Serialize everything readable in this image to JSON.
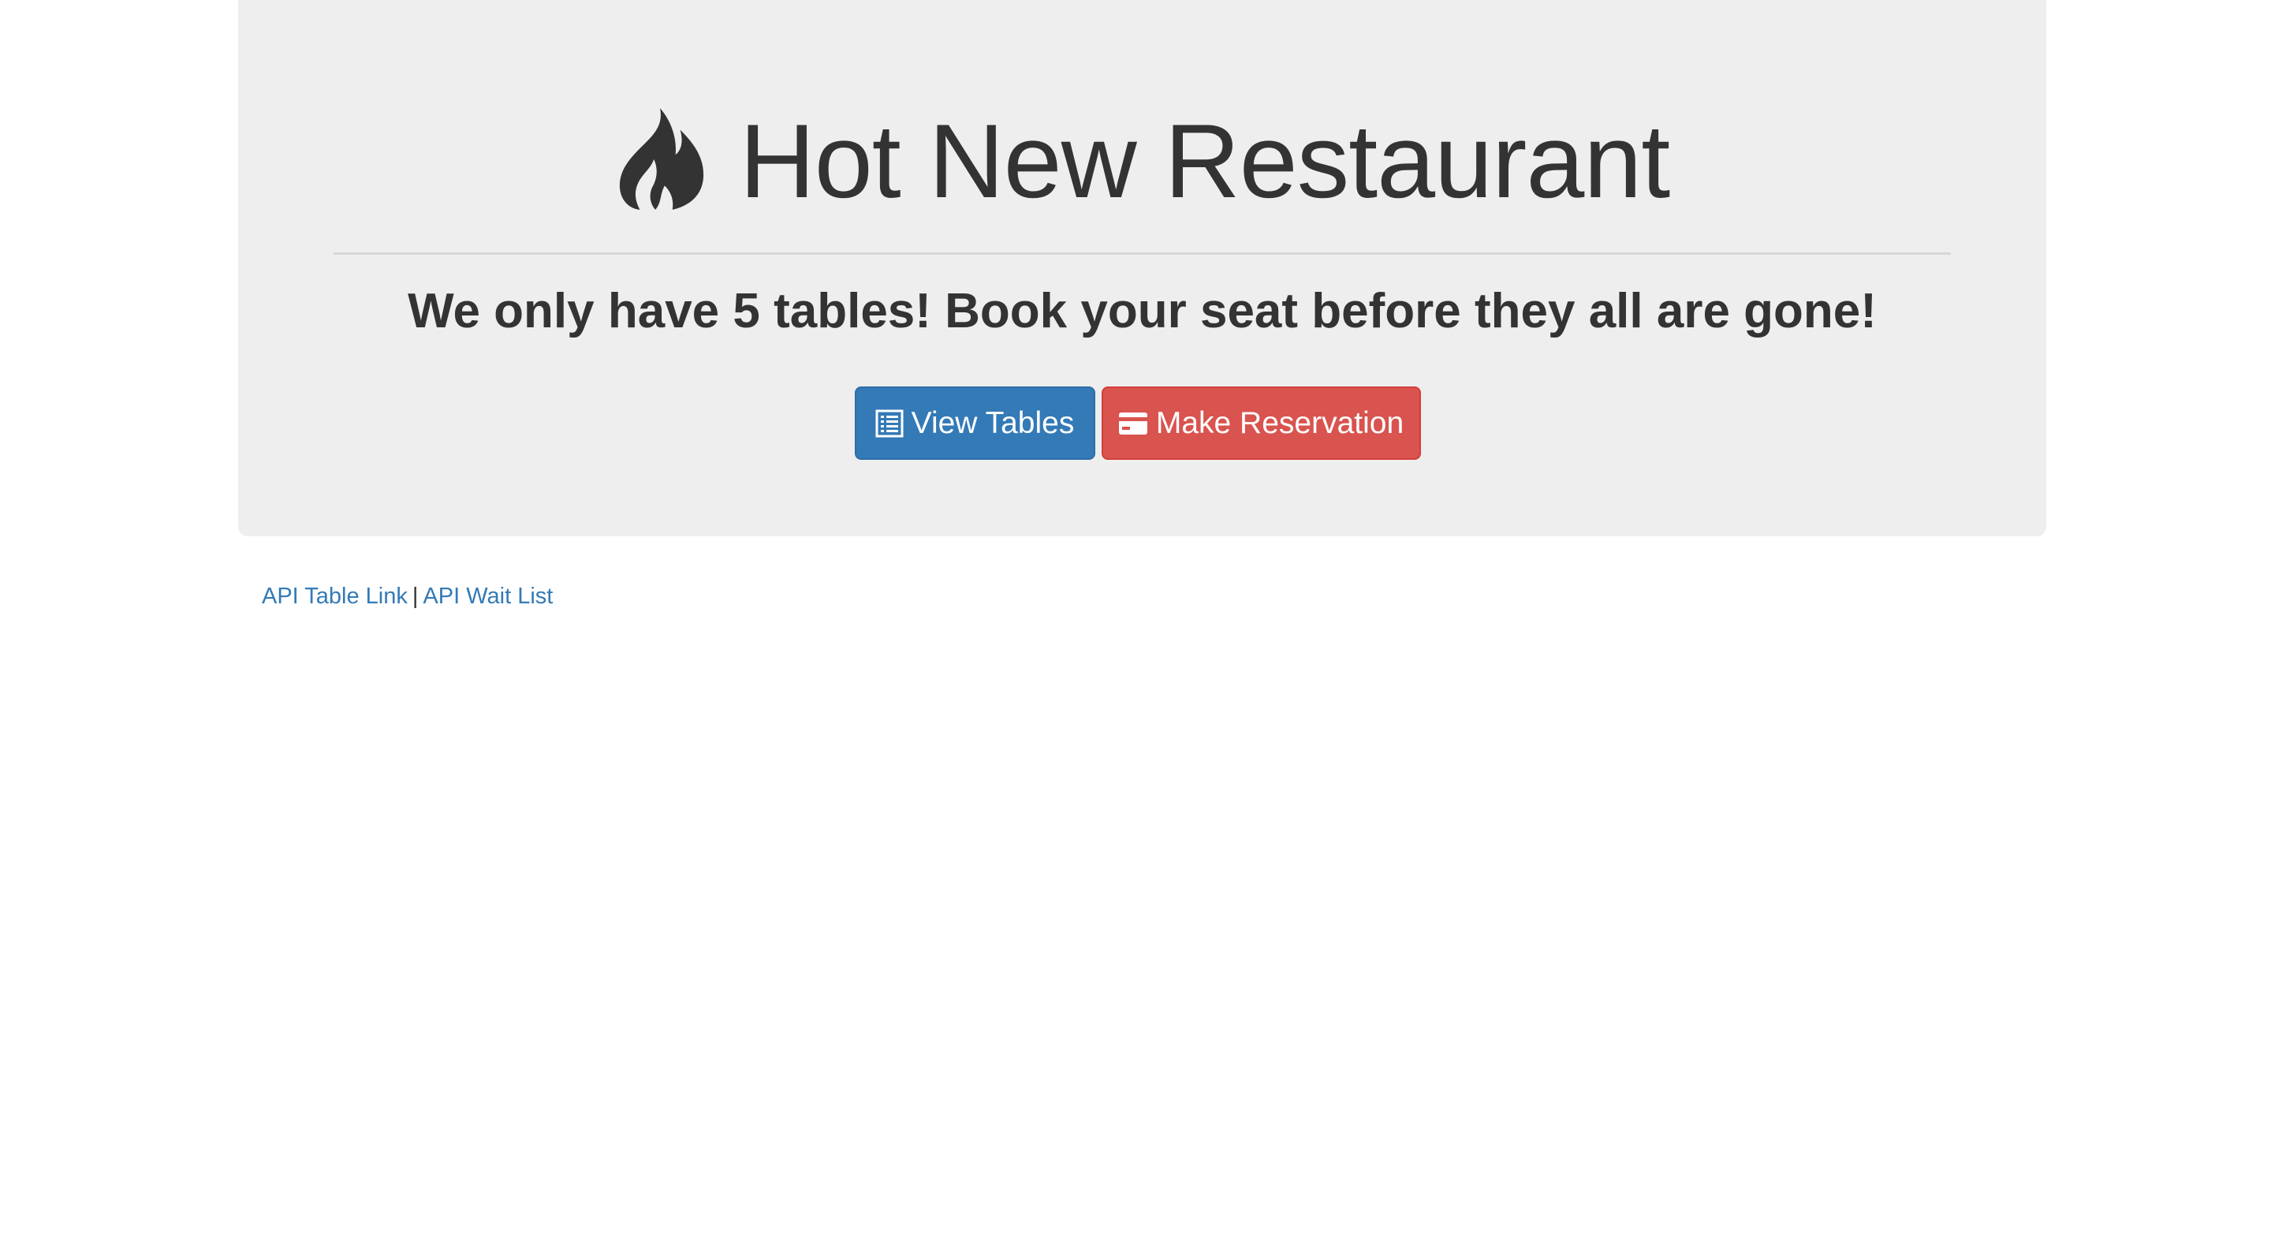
{
  "header": {
    "title": "Hot New Restaurant",
    "icon": "fire-icon",
    "subtitle": "We only have 5 tables! Book your seat before they all are gone!"
  },
  "actions": {
    "view_tables_label": "View Tables",
    "view_tables_icon": "list-icon",
    "make_reservation_label": "Make Reservation",
    "make_reservation_icon": "credit-card-icon"
  },
  "footer_links": {
    "api_table_label": "API Table Link",
    "separator": "|",
    "api_wait_list_label": "API Wait List"
  },
  "colors": {
    "jumbotron_bg": "#eeeeee",
    "primary": "#337ab7",
    "danger": "#d9534f",
    "text": "#333333",
    "link": "#337ab7"
  }
}
